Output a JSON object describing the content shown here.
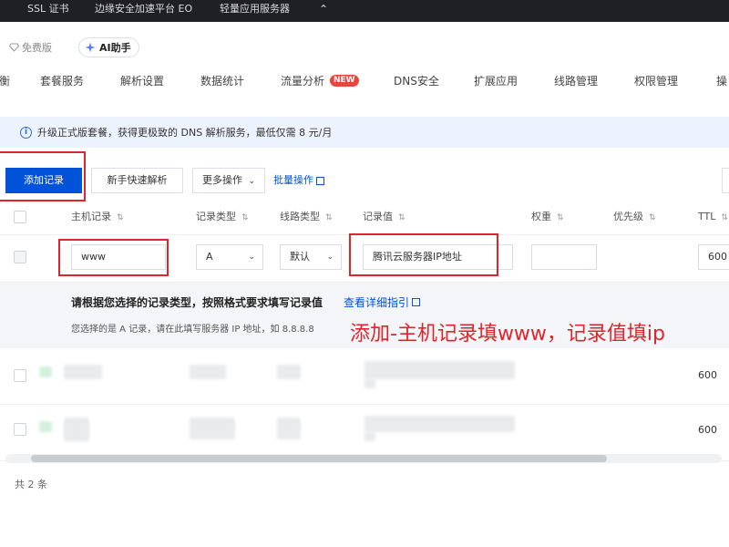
{
  "topbar": {
    "items": [
      "SSL 证书",
      "边缘安全加速平台 EO",
      "轻量应用服务器"
    ],
    "collapse_glyph": "⌃"
  },
  "header": {
    "edition_label": "免费版",
    "ai_label": "AI助手"
  },
  "nav": {
    "tabs": [
      "衡",
      "套餐服务",
      "解析设置",
      "数据统计",
      "流量分析",
      "DNS安全",
      "扩展应用",
      "线路管理",
      "权限管理",
      "操"
    ],
    "new_badge": "NEW"
  },
  "notice": {
    "text": "升级正式版套餐，获得更极致的 DNS 解析服务，最低仅需 8 元/月"
  },
  "toolbar": {
    "add_record": "添加记录",
    "quick_setup": "新手快速解析",
    "more_actions": "更多操作",
    "batch_actions": "批量操作"
  },
  "table": {
    "columns": [
      "主机记录",
      "记录类型",
      "线路类型",
      "记录值",
      "权重",
      "优先级",
      "TTL"
    ],
    "edit_row": {
      "host": "www",
      "type": "A",
      "line": "默认",
      "value": "腾讯云服务器IP地址",
      "weight": "",
      "ttl": "600"
    },
    "tip": {
      "title": "请根据您选择的记录类型，按照格式要求填写记录值",
      "link": "查看详细指引",
      "sub": "您选择的是 A 记录，请在此填写服务器 IP 地址，如 8.8.8.8"
    },
    "rows": [
      {
        "ttl": "600"
      },
      {
        "ttl": "600"
      }
    ],
    "total": "共 2 条"
  },
  "annotation": "添加-主机记录填www，记录值填ip",
  "colors": {
    "primary": "#0052d9",
    "highlight_red": "#e0242b",
    "notice_bg": "#edf3fe",
    "topbar_bg": "#1e2025"
  }
}
